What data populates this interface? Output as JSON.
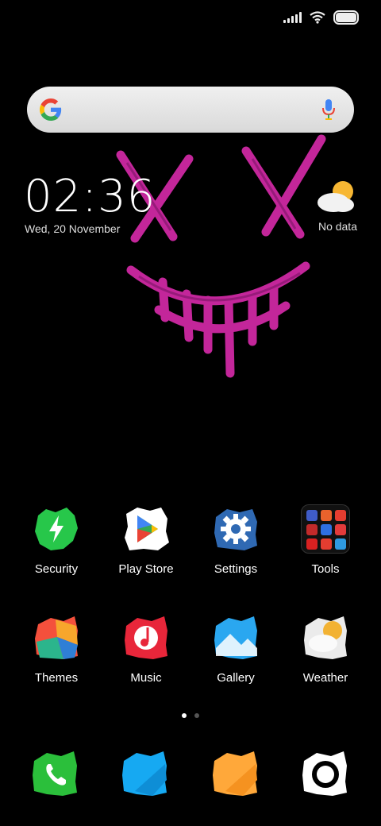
{
  "status_bar": {
    "signal_icon": "signal-bars-icon",
    "wifi_icon": "wifi-icon",
    "battery_icon": "battery-icon"
  },
  "search": {
    "logo": "google-g-logo",
    "mic_icon": "mic-icon"
  },
  "clock": {
    "time": "02:36",
    "date": "Wed, 20 November"
  },
  "weather_widget": {
    "icon": "partly-cloudy-icon",
    "text": "No data"
  },
  "apps": [
    {
      "label": "Security",
      "icon": "security-bolt-icon",
      "color": "#27c74a"
    },
    {
      "label": "Play Store",
      "icon": "play-store-icon",
      "color": "#ffffff"
    },
    {
      "label": "Settings",
      "icon": "settings-gear-icon",
      "color": "#3a7bd5"
    },
    {
      "label": "Tools",
      "icon": "tools-folder-icon",
      "color": "#111111"
    },
    {
      "label": "Themes",
      "icon": "themes-icon",
      "color": "#f4503c"
    },
    {
      "label": "Music",
      "icon": "music-note-icon",
      "color": "#e8263a"
    },
    {
      "label": "Gallery",
      "icon": "gallery-icon",
      "color": "#2aa7f0"
    },
    {
      "label": "Weather",
      "icon": "weather-icon",
      "color": "#f2b233"
    }
  ],
  "page_indicator": {
    "pages": 2,
    "current": 1
  },
  "dock": [
    {
      "icon": "phone-icon",
      "color": "#2bbf3b"
    },
    {
      "icon": "messages-icon",
      "color": "#16a9f2"
    },
    {
      "icon": "browser-icon",
      "color": "#ffa83a"
    },
    {
      "icon": "camera-icon",
      "color": "#ffffff"
    }
  ]
}
